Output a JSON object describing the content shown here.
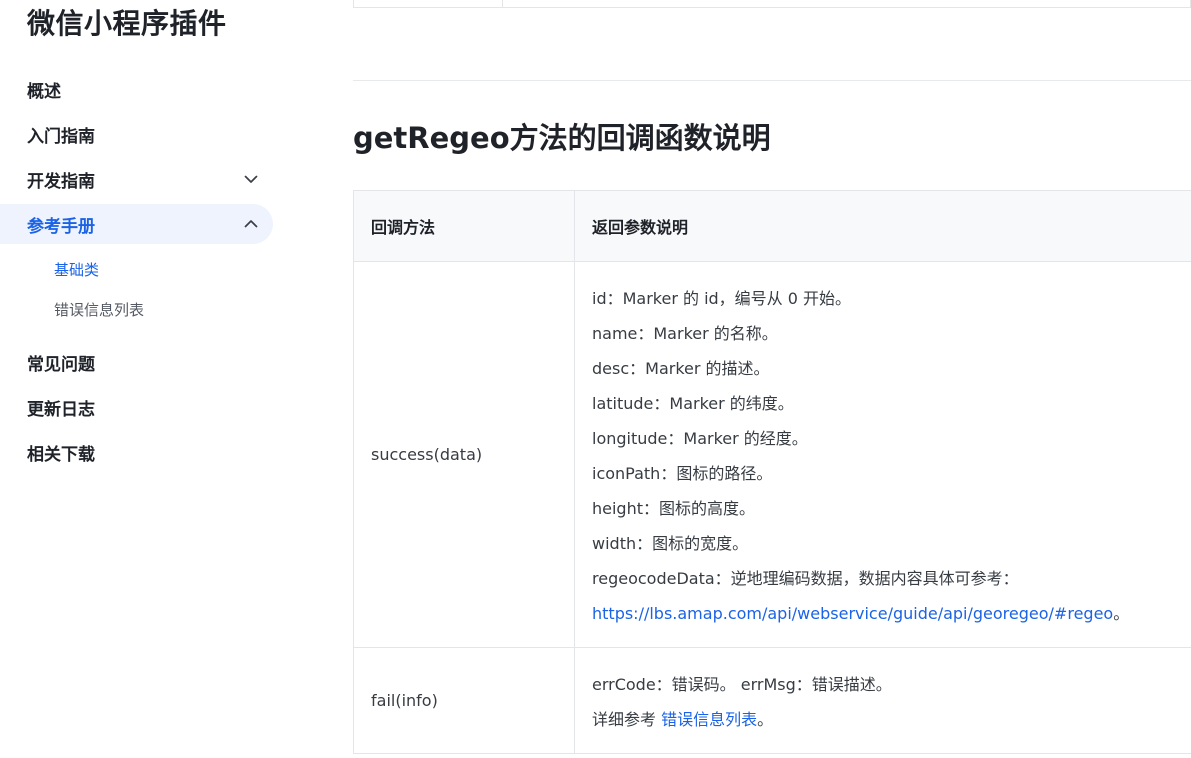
{
  "sidebar": {
    "site_title": "微信小程序插件",
    "items": [
      {
        "label": "概述"
      },
      {
        "label": "入门指南"
      },
      {
        "label": "开发指南"
      },
      {
        "label": "参考手册"
      },
      {
        "label": "常见问题"
      },
      {
        "label": "更新日志"
      },
      {
        "label": "相关下载"
      }
    ],
    "sub_items": [
      {
        "label": "基础类"
      },
      {
        "label": "错误信息列表"
      }
    ],
    "accent_color": "#1b63e6"
  },
  "main": {
    "section_title": "getRegeo方法的回调函数说明",
    "table": {
      "headers": [
        "回调方法",
        "返回参数说明"
      ],
      "rows": [
        {
          "method": "success(data)",
          "lines": [
            "id：Marker 的 id，编号从 0 开始。",
            "name：Marker 的名称。",
            "desc：Marker 的描述。",
            "latitude：Marker 的纬度。",
            "longitude：Marker 的经度。",
            "iconPath：图标的路径。",
            "height：图标的高度。",
            "width：图标的宽度。",
            "regeocodeData：逆地理编码数据，数据内容具体可参考："
          ],
          "link_text": "https://lbs.amap.com/api/webservice/guide/api/georegeo/#regeo",
          "link_suffix": "。"
        },
        {
          "method": "fail(info)",
          "line1": "errCode：错误码。 errMsg：错误描述。",
          "line2_prefix": "详细参考 ",
          "link_text": "错误信息列表",
          "link_suffix": "。"
        }
      ]
    }
  }
}
